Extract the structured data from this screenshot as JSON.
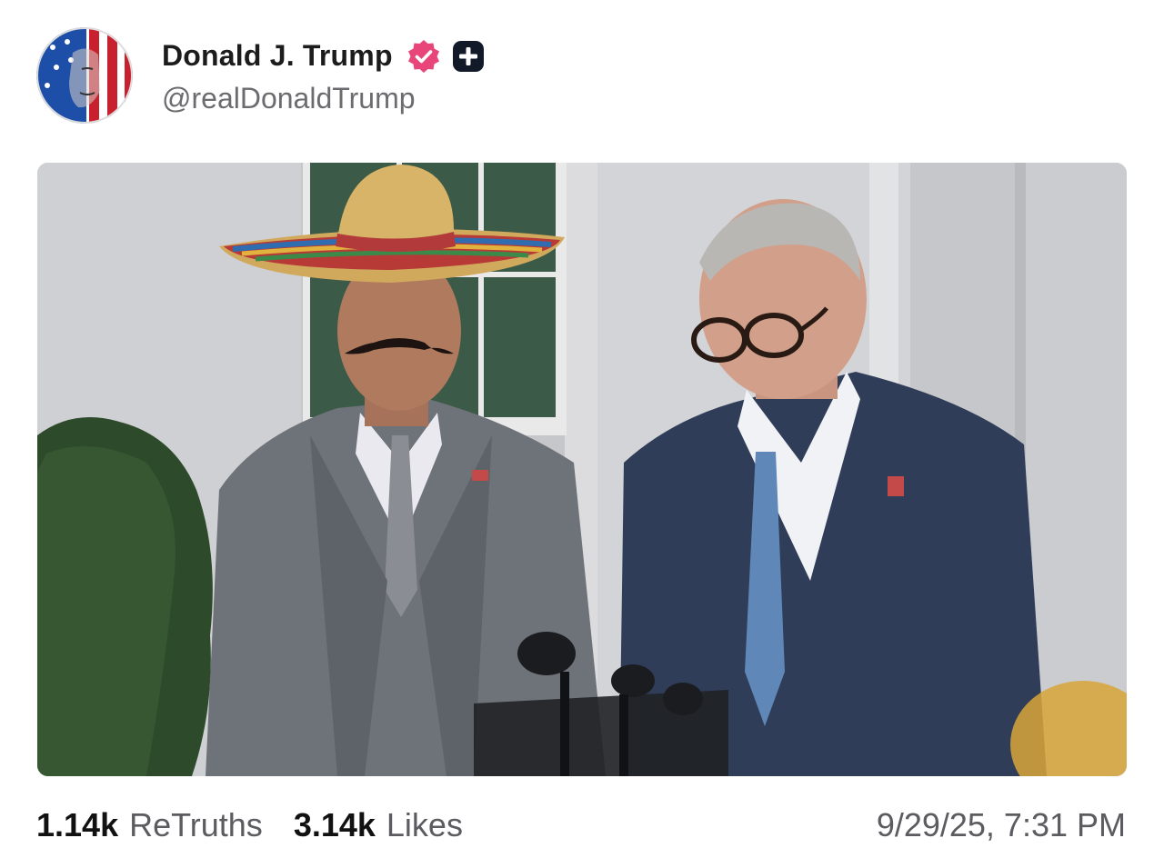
{
  "author": {
    "display_name": "Donald J. Trump",
    "handle": "@realDonaldTrump",
    "avatar_icon": "flag-face-avatar",
    "verified_icon": "verified-badge-icon",
    "verified_color": "#e8457a",
    "plus_icon": "plus-badge-icon"
  },
  "media": {
    "type": "video-still"
  },
  "stats": {
    "retruths_count": "1.14k",
    "retruths_label": "ReTruths",
    "likes_count": "3.14k",
    "likes_label": "Likes"
  },
  "timestamp": "9/29/25, 7:31 PM"
}
